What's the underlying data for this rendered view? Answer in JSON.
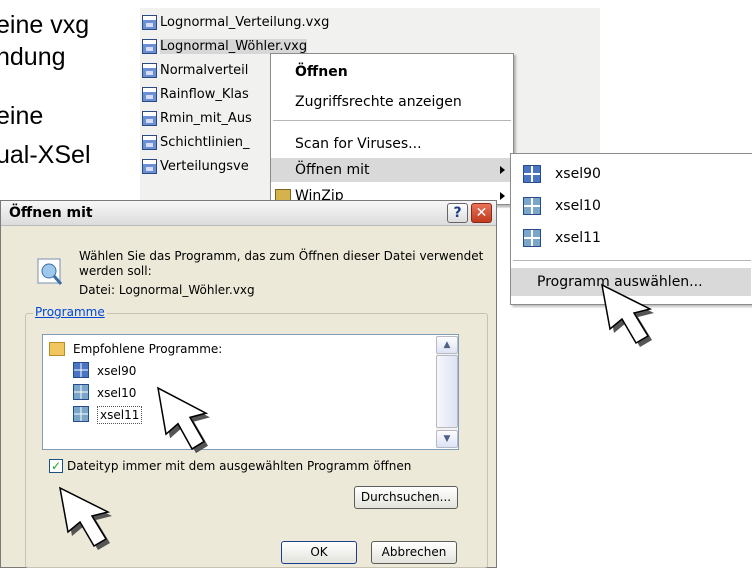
{
  "background_text": [
    "eine vxg",
    "ndung",
    "eine",
    "ual-XSel"
  ],
  "file_list": [
    "Lognormal_Verteilung.vxg",
    "Lognormal_Wöhler.vxg",
    "Normalverteil",
    "Rainflow_Klas",
    "Rmin_mit_Aus",
    "Schichtlinien_",
    "Verteilungsve"
  ],
  "context_menu": {
    "open": "Öffnen",
    "permissions": "Zugriffsrechte anzeigen",
    "scan": "Scan for Viruses...",
    "open_with": "Öffnen mit",
    "winzip": "WinZip"
  },
  "submenu": {
    "items": [
      "xsel90",
      "xsel10",
      "xsel11"
    ],
    "choose_program": "Programm auswählen..."
  },
  "dialog": {
    "title": "Öffnen mit",
    "help_btn": "?",
    "close_btn": "✕",
    "instruction": "Wählen Sie das Programm, das zum Öffnen dieser Datei verwendet werden soll:",
    "file_label": "Datei:  Lognormal_Wöhler.vxg",
    "group_label": "Programme",
    "recommended": "Empfohlene Programme:",
    "programs": [
      "xsel90",
      "xsel10",
      "xsel11"
    ],
    "checkbox_label": "Dateityp immer mit dem ausgewählten Programm öffnen",
    "browse": "Durchsuchen...",
    "ok": "OK",
    "cancel": "Abbrechen"
  },
  "icons": [
    "file-icon",
    "program-icon",
    "folder-icon",
    "info-icon",
    "pointer-arrow-icon"
  ],
  "colors": {
    "dialog_bg": "#ece9d8",
    "link_blue": "#0046d5",
    "list_border": "#7f9db9"
  }
}
